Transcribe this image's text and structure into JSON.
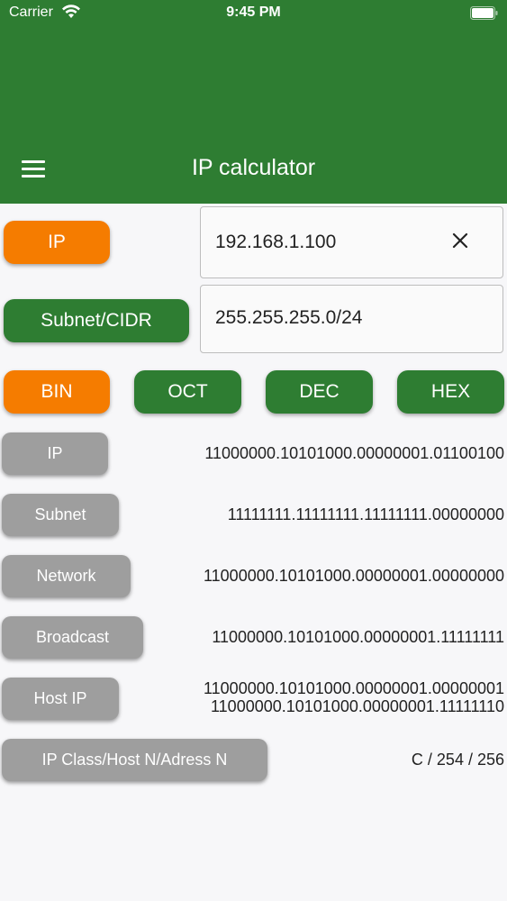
{
  "status": {
    "carrier": "Carrier",
    "time": "9:45 PM"
  },
  "appbar": {
    "title": "IP calculator",
    "menu_icon": "hamburger-menu-icon",
    "color": "#2e7d32"
  },
  "inputs": {
    "ip_label": "IP",
    "ip_value": "192.168.1.100",
    "subnet_label": "Subnet/CIDR",
    "subnet_value": "255.255.255.0/24"
  },
  "format_buttons": [
    {
      "label": "BIN",
      "selected": true
    },
    {
      "label": "OCT",
      "selected": false
    },
    {
      "label": "DEC",
      "selected": false
    },
    {
      "label": "HEX",
      "selected": false
    }
  ],
  "results": [
    {
      "label": "IP",
      "value": "11000000.10101000.00000001.01100100"
    },
    {
      "label": "Subnet",
      "value": "11111111.11111111.11111111.00000000"
    },
    {
      "label": "Network",
      "value": "11000000.10101000.00000001.00000000"
    },
    {
      "label": "Broadcast",
      "value": "11000000.10101000.00000001.11111111"
    },
    {
      "label": "Host IP",
      "value_line1": "11000000.10101000.00000001.00000001",
      "value_line2": "11000000.10101000.00000001.11111110"
    },
    {
      "label": "IP Class/Host N/Adress N",
      "value": "C / 254 / 256"
    }
  ],
  "colors": {
    "accent_orange": "#f57c00",
    "primary_green": "#2e7d32",
    "neutral_gray": "#9e9e9e"
  }
}
